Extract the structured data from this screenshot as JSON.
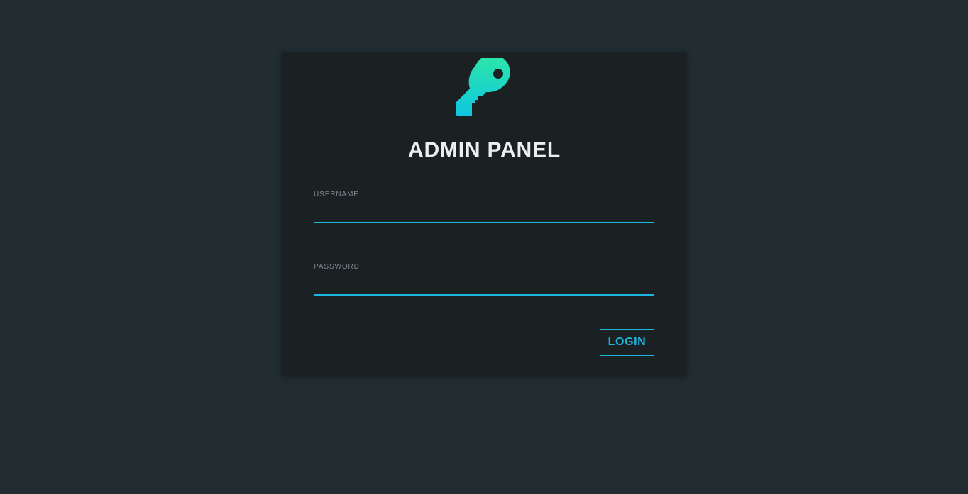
{
  "login": {
    "title": "ADMIN PANEL",
    "icon": "key-icon",
    "username": {
      "label": "USERNAME",
      "value": "",
      "placeholder": ""
    },
    "password": {
      "label": "PASSWORD",
      "value": "",
      "placeholder": ""
    },
    "button_label": "LOGIN"
  },
  "colors": {
    "page_background": "#222d32",
    "card_background": "#1b2023",
    "accent": "#1ab6dd",
    "icon_gradient_start": "#2ee6a6",
    "icon_gradient_end": "#0fc7df",
    "title_text": "#eceff1",
    "label_text": "#7f8a90"
  }
}
